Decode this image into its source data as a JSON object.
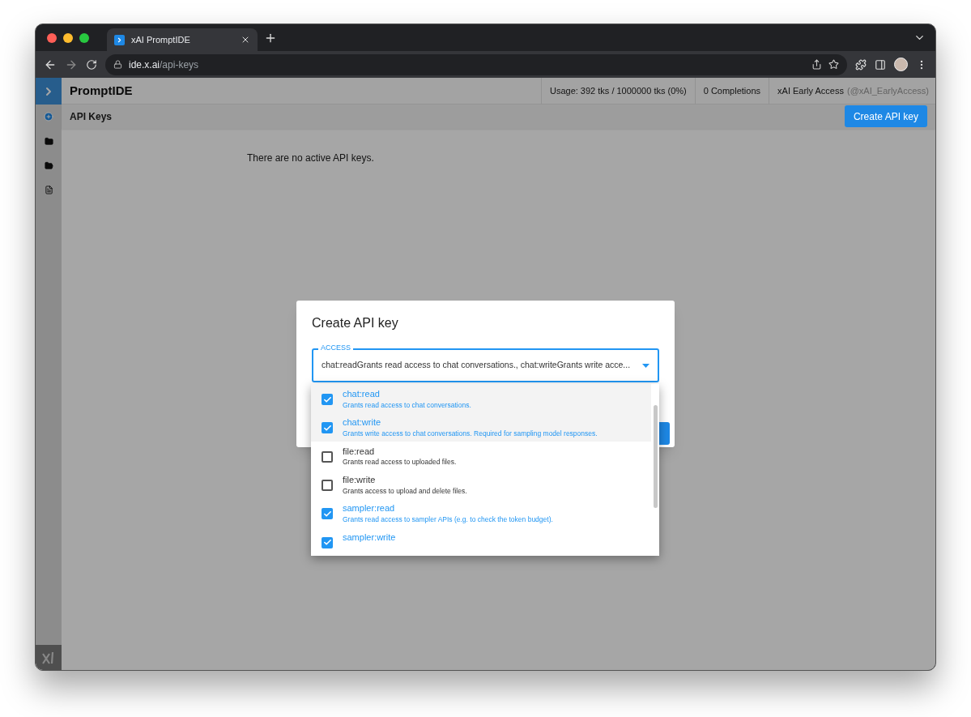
{
  "browser": {
    "tab_title": "xAI PromptIDE",
    "url_host": "ide.x.ai",
    "url_path": "/api-keys"
  },
  "header": {
    "app_title": "PromptIDE",
    "usage": "Usage: 392 tks / 1000000 tks (0%)",
    "completions": "0 Completions",
    "account": "xAI Early Access",
    "handle": "(@xAI_EarlyAccess)"
  },
  "subheader": {
    "title": "API Keys",
    "button": "Create API key"
  },
  "empty_message": "There are no active API keys.",
  "dialog": {
    "title": "Create API key",
    "field_label": "ACCESS",
    "field_value": "chat:readGrants read access to chat conversations., chat:writeGrants write acce...",
    "options": [
      {
        "name": "chat:read",
        "description": "Grants read access to chat conversations.",
        "checked": true,
        "highlighted": true
      },
      {
        "name": "chat:write",
        "description": "Grants write access to chat conversations. Required for sampling model responses.",
        "checked": true,
        "highlighted": true
      },
      {
        "name": "file:read",
        "description": "Grants read access to uploaded files.",
        "checked": false,
        "highlighted": false
      },
      {
        "name": "file:write",
        "description": "Grants access to upload and delete files.",
        "checked": false,
        "highlighted": false
      },
      {
        "name": "sampler:read",
        "description": "Grants read access to sampler APIs (e.g. to check the token budget).",
        "checked": true,
        "highlighted": false
      },
      {
        "name": "sampler:write",
        "checked": true,
        "highlighted": false
      }
    ]
  }
}
